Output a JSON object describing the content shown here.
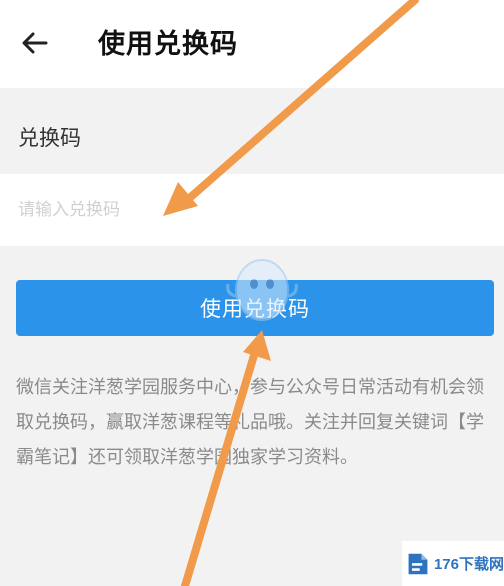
{
  "header": {
    "title": "使用兑换码",
    "back_icon": "arrow-left-icon"
  },
  "form": {
    "field_label": "兑换码",
    "input_value": "",
    "input_placeholder": "请输入兑换码",
    "submit_label": "使用兑换码"
  },
  "description": "微信关注洋葱学园服务中心，参与公众号日常活动有机会领取兑换码，赢取洋葱课程等礼品哦。关注并回复关键词【学霸笔记】还可领取洋葱学园独家学习资料。",
  "watermark": {
    "site_name": "176下载网",
    "annotation_color": "#f09a4a",
    "mascot_icon": "mascot-watermark-icon"
  },
  "colors": {
    "accent": "#2b93e9",
    "background": "#f2f2f2"
  }
}
